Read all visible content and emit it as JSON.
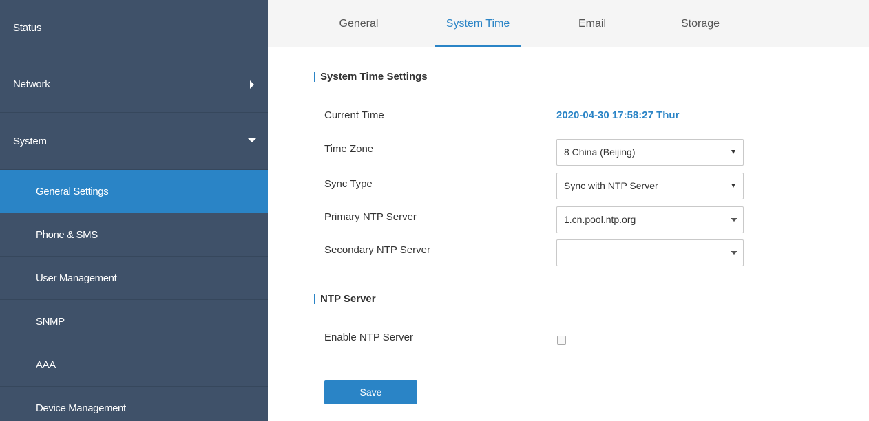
{
  "sidebar": {
    "top_items": [
      {
        "label": "Status"
      },
      {
        "label": "Network"
      },
      {
        "label": "System"
      }
    ],
    "sub_items": [
      {
        "label": "General Settings",
        "active": true
      },
      {
        "label": "Phone & SMS"
      },
      {
        "label": "User Management"
      },
      {
        "label": "SNMP"
      },
      {
        "label": "AAA"
      },
      {
        "label": "Device Management"
      }
    ]
  },
  "tabs": [
    {
      "label": "General"
    },
    {
      "label": "System Time",
      "active": true
    },
    {
      "label": "Email"
    },
    {
      "label": "Storage"
    }
  ],
  "system_time": {
    "section_title": "System Time Settings",
    "current_time_label": "Current Time",
    "current_time_value": "2020-04-30 17:58:27 Thur",
    "time_zone_label": "Time Zone",
    "time_zone_value": "8 China (Beijing)",
    "sync_type_label": "Sync Type",
    "sync_type_value": "Sync with NTP Server",
    "primary_ntp_label": "Primary NTP Server",
    "primary_ntp_value": "1.cn.pool.ntp.org",
    "secondary_ntp_label": "Secondary NTP Server",
    "secondary_ntp_value": ""
  },
  "ntp_server": {
    "section_title": "NTP Server",
    "enable_label": "Enable NTP Server",
    "enabled": false
  },
  "save_label": "Save",
  "colors": {
    "sidebar_bg": "#3f5169",
    "accent": "#2a84c6",
    "tabbar_bg": "#f5f5f5"
  }
}
